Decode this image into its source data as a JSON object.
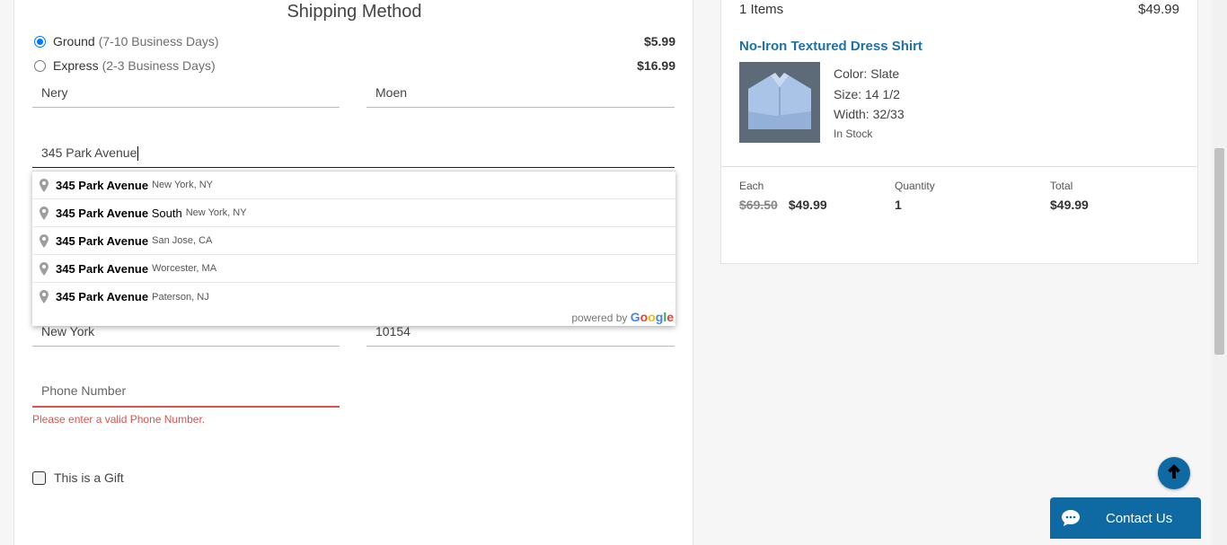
{
  "shipping": {
    "title": "Shipping Method",
    "options": [
      {
        "name": "Ground",
        "days": "(7-10 Business Days)",
        "price": "$5.99",
        "selected": true
      },
      {
        "name": "Express",
        "days": "(2-3 Business Days)",
        "price": "$16.99",
        "selected": false
      }
    ]
  },
  "form": {
    "first_name": "Nery",
    "last_name": "Moen",
    "address": "345 Park Avenue",
    "city": "New York",
    "zip": "10154",
    "phone_placeholder": "Phone Number",
    "phone_error": "Please enter a valid Phone Number.",
    "gift_label": "This is a Gift"
  },
  "autocomplete": {
    "items": [
      {
        "main_bold": "345 Park Avenue",
        "main_rest": "",
        "secondary": "New York, NY"
      },
      {
        "main_bold": "345 Park Avenue",
        "main_rest": " South",
        "secondary": "New York, NY"
      },
      {
        "main_bold": "345 Park Avenue",
        "main_rest": "",
        "secondary": "San Jose, CA"
      },
      {
        "main_bold": "345 Park Avenue",
        "main_rest": "",
        "secondary": "Worcester, MA"
      },
      {
        "main_bold": "345 Park Avenue",
        "main_rest": "",
        "secondary": "Paterson, NJ"
      }
    ],
    "powered_by": "powered by",
    "google": "Google"
  },
  "summary": {
    "items_count": "1 Items",
    "items_total": "$49.99",
    "product": {
      "name": "No-Iron Textured Dress Shirt",
      "color": "Color: Slate",
      "size": "Size: 14 1/2",
      "width": "Width: 32/33",
      "stock": "In Stock"
    },
    "each_label": "Each",
    "each_original": "$69.50",
    "each_price": "$49.99",
    "quantity_label": "Quantity",
    "quantity": "1",
    "total_label": "Total",
    "total": "$49.99"
  },
  "contact": {
    "label": "Contact Us"
  },
  "colors": {
    "accent": "#0f6aa3",
    "link": "#1a73a8",
    "error": "#d9534f"
  }
}
